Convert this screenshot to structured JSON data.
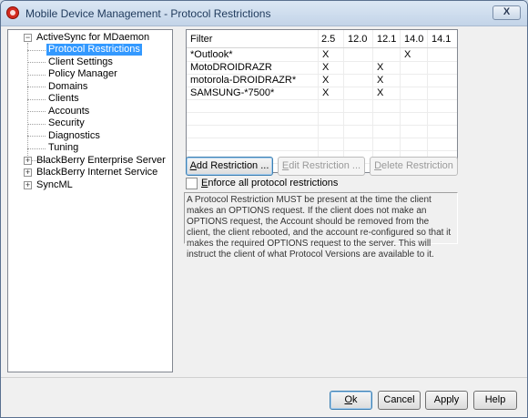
{
  "window": {
    "title": "Mobile Device Management - Protocol Restrictions",
    "close_glyph": "X"
  },
  "tree": {
    "root_expanded": "−",
    "collapsed_glyph": "+",
    "items": [
      {
        "label": "ActiveSync for MDaemon"
      },
      {
        "label": "Protocol Restrictions"
      },
      {
        "label": "Client Settings"
      },
      {
        "label": "Policy Manager"
      },
      {
        "label": "Domains"
      },
      {
        "label": "Clients"
      },
      {
        "label": "Accounts"
      },
      {
        "label": "Security"
      },
      {
        "label": "Diagnostics"
      },
      {
        "label": "Tuning"
      },
      {
        "label": "BlackBerry Enterprise Server"
      },
      {
        "label": "BlackBerry Internet Service"
      },
      {
        "label": "SyncML"
      }
    ]
  },
  "grid": {
    "columns": [
      "Filter",
      "2.5",
      "12.0",
      "12.1",
      "14.0",
      "14.1"
    ],
    "rows": [
      {
        "filter": "*Outlook*",
        "v25": "X",
        "v120": "",
        "v121": "",
        "v140": "X",
        "v141": ""
      },
      {
        "filter": "MotoDROIDRAZR",
        "v25": "X",
        "v120": "",
        "v121": "X",
        "v140": "",
        "v141": ""
      },
      {
        "filter": "motorola-DROIDRAZR*",
        "v25": "X",
        "v120": "",
        "v121": "X",
        "v140": "",
        "v141": ""
      },
      {
        "filter": "SAMSUNG-*7500*",
        "v25": "X",
        "v120": "",
        "v121": "X",
        "v140": "",
        "v141": ""
      }
    ]
  },
  "buttons": {
    "add": "Add Restriction ...",
    "edit": "Edit Restriction ...",
    "delete": "Delete Restriction",
    "ok": "Ok",
    "cancel": "Cancel",
    "apply": "Apply",
    "help": "Help"
  },
  "enforce": {
    "label": "Enforce all protocol restrictions",
    "checked": false
  },
  "note": "A Protocol Restriction MUST be present at the time the client makes an OPTIONS request. If the client does not make an OPTIONS request, the Account should be removed from the client, the client rebooted, and the account re-configured so that it makes the required OPTIONS request to the server. This will instruct the client of what Protocol Versions are available to it."
}
